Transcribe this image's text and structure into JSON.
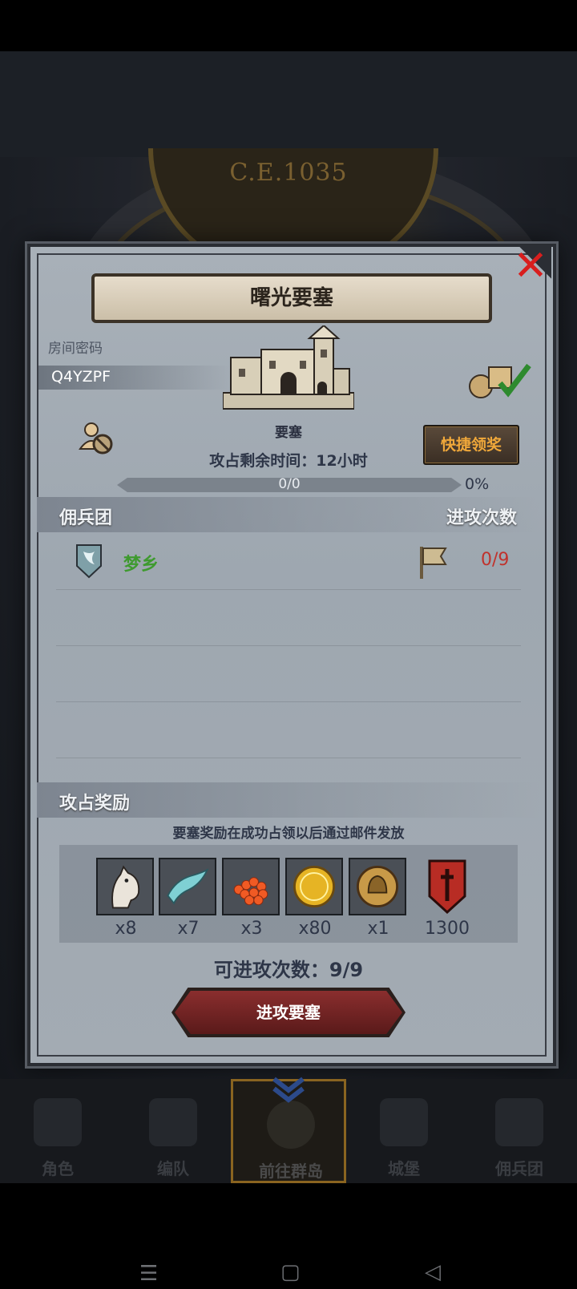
{
  "background": {
    "era": "C.E.1035"
  },
  "dialog": {
    "title": "曙光要塞",
    "close_label": "✕",
    "room_code_label": "房间密码",
    "room_code": "Q4YZPF",
    "building_name": "要塞",
    "quick_claim_label": "快捷领奖",
    "remaining_time": "攻占剩余时间：12小时",
    "progress_text": "0/0",
    "progress_percent_text": "0%",
    "progress_fraction": 0
  },
  "mercenary": {
    "header_left": "佣兵团",
    "header_right": "进攻次数",
    "rows": [
      {
        "name": "梦乡",
        "attacks": "0/9"
      }
    ]
  },
  "rewards": {
    "header": "攻占奖励",
    "note": "要塞奖励在成功占领以后通过邮件发放",
    "items": [
      {
        "icon": "horse-icon",
        "qty": "x8"
      },
      {
        "icon": "cloth-icon",
        "qty": "x7"
      },
      {
        "icon": "berries-icon",
        "qty": "x3"
      },
      {
        "icon": "gold-coin-icon",
        "qty": "x80"
      },
      {
        "icon": "helmet-medal-icon",
        "qty": "x1"
      },
      {
        "icon": "banner-icon",
        "qty": "1300"
      }
    ]
  },
  "attack": {
    "attempts": "可进攻次数：9/9",
    "button_label": "进攻要塞"
  },
  "bottom_nav": {
    "tabs": [
      {
        "label": "角色"
      },
      {
        "label": "编队"
      },
      {
        "label": "前往群岛"
      },
      {
        "label": "城堡"
      },
      {
        "label": "佣兵团"
      }
    ]
  },
  "colors": {
    "accent_gold": "#f0a83a",
    "enemy_red": "#c0322c",
    "name_green": "#3e9a2e"
  }
}
